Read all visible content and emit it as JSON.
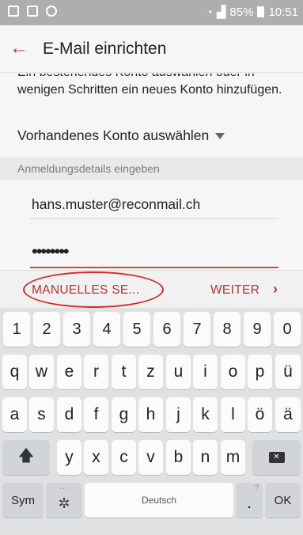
{
  "status_bar": {
    "battery": "85%",
    "time": "10:51"
  },
  "app_bar": {
    "title": "E-Mail einrichten"
  },
  "content": {
    "description": "Ein bestehendes Konto auswählen oder in wenigen Schritten ein neues Konto hinzufügen.",
    "account_picker": "Vorhandenes Konto auswählen",
    "section_header": "Anmeldungsdetails eingeben",
    "email_value": "hans.muster@reconmail.ch",
    "password_value": "••••••••"
  },
  "actions": {
    "manual_setup": "MANUELLES SE...",
    "next": "WEITER",
    "next_chevron": "›"
  },
  "keyboard": {
    "numbers": [
      "1",
      "2",
      "3",
      "4",
      "5",
      "6",
      "7",
      "8",
      "9",
      "0"
    ],
    "row1": [
      "q",
      "w",
      "e",
      "r",
      "t",
      "z",
      "u",
      "i",
      "o",
      "p",
      "ü"
    ],
    "row2": [
      "a",
      "s",
      "d",
      "f",
      "g",
      "h",
      "j",
      "k",
      "l",
      "ö",
      "ä"
    ],
    "row3": [
      "y",
      "x",
      "c",
      "v",
      "b",
      "n",
      "m"
    ],
    "sym": "Sym",
    "space": "Deutsch",
    "period": ".",
    "ok": "OK",
    "accent_colors": {
      "accent": "#b5332e",
      "annotation": "#d72a2a"
    }
  }
}
